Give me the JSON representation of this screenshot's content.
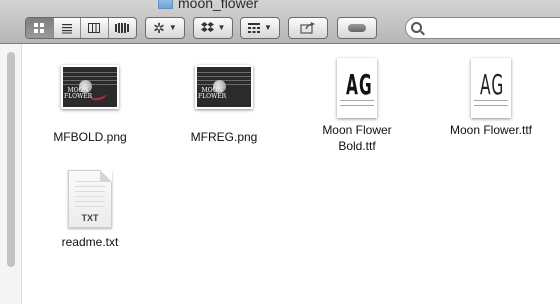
{
  "window": {
    "title": "moon_flower"
  },
  "toolbar": {
    "view_buttons": [
      {
        "name": "icon-view",
        "icon": "grid-icon",
        "active": true
      },
      {
        "name": "list-view",
        "icon": "list-icon",
        "active": false
      },
      {
        "name": "column-view",
        "icon": "columns-icon",
        "active": false
      },
      {
        "name": "coverflow-view",
        "icon": "coverflow-icon",
        "active": false
      }
    ],
    "action_icon": "gear-icon",
    "dropbox_icon": "dropbox-icon",
    "arrange_icon": "arrange-icon",
    "share_icon": "share-icon",
    "toggle_icon": "toggle-icon",
    "search_placeholder": ""
  },
  "files": [
    {
      "name": "MFBOLD.png",
      "kind": "png",
      "thumb_text": "MOON\nFLOWER"
    },
    {
      "name": "MFREG.png",
      "kind": "png",
      "thumb_text": "MOON\nFLOWER"
    },
    {
      "name": "Moon Flower\nBold.ttf",
      "kind": "ttf",
      "glyphs": "AG",
      "weight": "bold"
    },
    {
      "name": "Moon Flower.ttf",
      "kind": "ttf",
      "glyphs": "AG",
      "weight": "regular"
    },
    {
      "name": "readme.txt",
      "kind": "txt",
      "badge": "TXT"
    }
  ]
}
